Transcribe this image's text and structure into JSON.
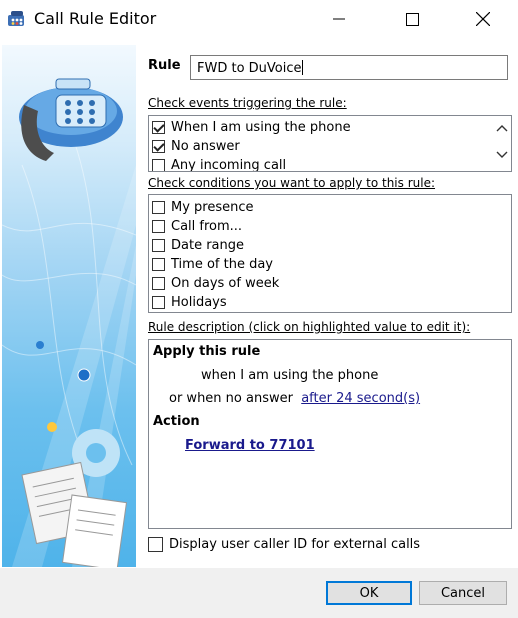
{
  "window": {
    "title": "Call Rule Editor"
  },
  "rule": {
    "label": "Rule",
    "name": "FWD to DuVoice"
  },
  "events": {
    "label": "Check events triggering the rule:",
    "items": [
      {
        "label": "When I am using the phone",
        "checked": true
      },
      {
        "label": "No answer",
        "checked": true
      },
      {
        "label": "Any incoming call",
        "checked": false
      }
    ]
  },
  "conditions": {
    "label": "Check conditions you want to apply to this rule:",
    "items": [
      {
        "label": "My presence",
        "checked": false
      },
      {
        "label": "Call from...",
        "checked": false
      },
      {
        "label": "Date range",
        "checked": false
      },
      {
        "label": "Time of the day",
        "checked": false
      },
      {
        "label": "On days of week",
        "checked": false
      },
      {
        "label": "Holidays",
        "checked": false
      }
    ]
  },
  "description": {
    "label": "Rule description (click on highlighted value to edit it):",
    "apply_heading": "Apply this rule",
    "line1": "when I am using the phone",
    "line2_prefix": "or when no answer",
    "line2_link": "after 24 second(s)",
    "action_heading": "Action",
    "action_link": "Forward to 77101"
  },
  "external_caller_id": {
    "label": "Display user caller ID for external calls",
    "checked": false
  },
  "buttons": {
    "ok": "OK",
    "cancel": "Cancel"
  },
  "icons": {
    "app": "phone-app-icon",
    "minimize": "minimize-icon",
    "maximize": "maximize-icon",
    "close": "close-icon",
    "sidebar_phone": "telephone-icon",
    "scroll_up": "chevron-up-icon",
    "scroll_down": "chevron-down-icon"
  }
}
